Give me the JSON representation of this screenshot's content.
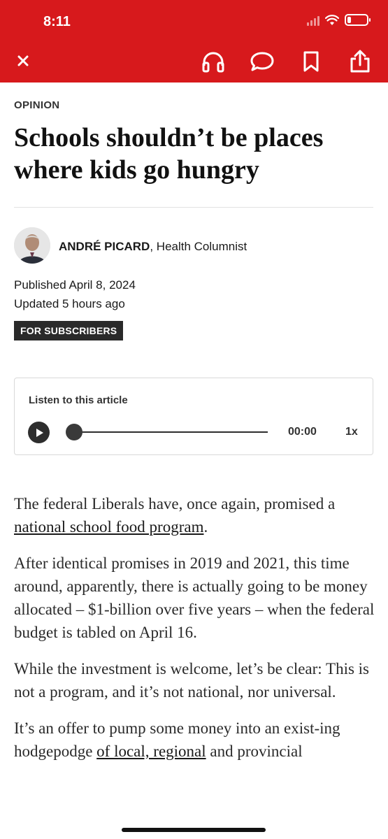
{
  "status_bar": {
    "time": "8:11",
    "battery_fraction": 0.2
  },
  "nav": {
    "close": "close-icon",
    "actions": [
      "headphones-icon",
      "comment-icon",
      "bookmark-icon",
      "share-icon"
    ]
  },
  "article": {
    "kicker": "OPINION",
    "headline": "Schools shouldn’t be places where kids go hungry",
    "author_name": "ANDRÉ PICARD",
    "author_role": ", Health Columnist",
    "published": "Published April 8, 2024",
    "updated": "Updated 5 hours ago",
    "badge": "FOR SUBSCRIBERS",
    "paragraphs": {
      "p1_pre": "The federal Liberals have, once again, promised a ",
      "p1_link": "national school food program",
      "p1_post": ".",
      "p2": "After identical promises in 2019 and 2021, this time around, apparently, there is actually going to be money allocated – $1-billion over five years – when the federal budget is tabled on April 16.",
      "p3": "While the investment is welcome, let’s be clear: This is not a program, and it’s not national, nor universal.",
      "p4_pre": "It’s an offer to pump some money into an exist-ing hodgepodge ",
      "p4_link1": "of local, regional",
      "p4_post": " and provincial"
    }
  },
  "audio": {
    "label": "Listen to this article",
    "time": "00:00",
    "speed": "1x",
    "progress": 0
  },
  "colors": {
    "brand_red": "#d7191c",
    "badge_bg": "#2a2a2a"
  }
}
